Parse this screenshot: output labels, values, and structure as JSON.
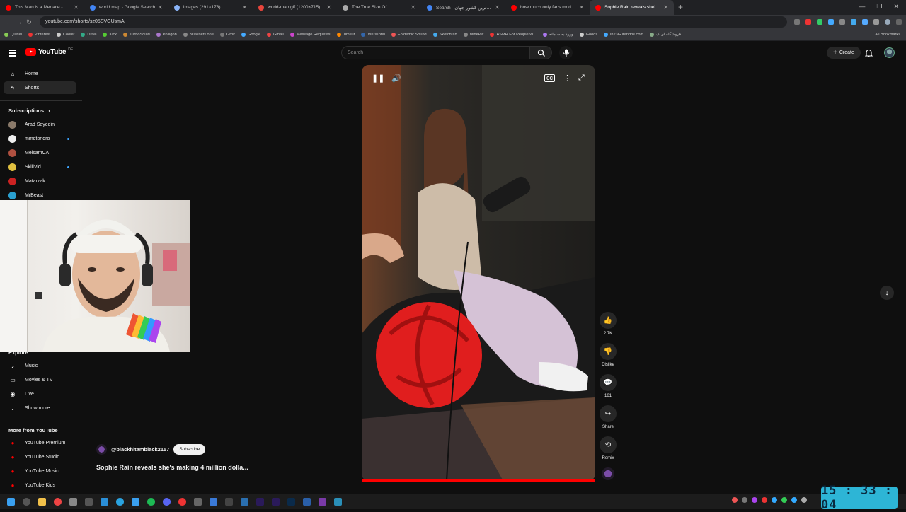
{
  "browser": {
    "tabs": [
      {
        "title": "This Man is a Menace - YouTube",
        "color": "#ff0000"
      },
      {
        "title": "world map - Google Search",
        "color": "#4285f4"
      },
      {
        "title": "images (291×173)",
        "color": "#8ab4f8"
      },
      {
        "title": "world-map.gif (1200×715)",
        "color": "#e8453c"
      },
      {
        "title": "The True Size Of ...",
        "color": "#aaaaaa"
      },
      {
        "title": "Search - پهناور ترین کشور جهان",
        "color": "#4285f4"
      },
      {
        "title": "how much only fans models m",
        "color": "#ff0000"
      },
      {
        "title": "Sophie Rain reveals she's m",
        "color": "#ff0000"
      }
    ],
    "new_tab": "+",
    "url": "youtube.com/shorts/sz05SVGUsmA",
    "bookmarks": [
      "Quixel",
      "Pinterest",
      "Cooler",
      "Drive",
      "Kick",
      "TurboSquid",
      "Poliigon",
      "3Dassets.one",
      "Grok",
      "Google",
      "Gmail",
      "Message Requests",
      "Time.ir",
      "VirusTotal",
      "Epidemic Sound",
      "Sketchfab",
      "MinePic",
      "ASMR For People W...",
      "ورود به سامانه",
      "Goods",
      "lh23G.irandns.com",
      "فروشگاه ای ک"
    ],
    "all_bookmarks": "All Bookmarks"
  },
  "youtube": {
    "logo_text": "YouTube",
    "region": "DE",
    "search_placeholder": "Search",
    "create_label": "Create",
    "sidebar": {
      "main": [
        {
          "label": "Home",
          "icon": "home-icon"
        },
        {
          "label": "Shorts",
          "icon": "shorts-icon"
        }
      ],
      "subscriptions_header": "Subscriptions",
      "subscriptions": [
        {
          "label": "Arad Seyedin",
          "color": "#8a7a6a",
          "dot": false
        },
        {
          "label": "mmdtondro",
          "color": "#eeeeee",
          "dot": true
        },
        {
          "label": "MeisamCA",
          "color": "#b05040",
          "dot": false
        },
        {
          "label": "SkillVid",
          "color": "#e0c040",
          "dot": true
        },
        {
          "label": "Matarzak",
          "color": "#cc2222",
          "dot": false
        },
        {
          "label": "MrBeast",
          "color": "#2aa0d0",
          "dot": false
        }
      ],
      "explore_header": "Explore",
      "explore": [
        {
          "label": "Music",
          "icon": "music-icon"
        },
        {
          "label": "Movies & TV",
          "icon": "movies-icon"
        },
        {
          "label": "Live",
          "icon": "live-icon"
        },
        {
          "label": "Show more",
          "icon": "chevron-down-icon"
        }
      ],
      "more_header": "More from YouTube",
      "more": [
        {
          "label": "YouTube Premium"
        },
        {
          "label": "YouTube Studio"
        },
        {
          "label": "YouTube Music"
        },
        {
          "label": "YouTube Kids"
        }
      ]
    },
    "short": {
      "channel": "@blackhitamblack2157",
      "subscribe": "Subscribe",
      "title": "Sophie Rain reveals she's making 4 million dolla...",
      "actions": {
        "like_count": "2.7K",
        "dislike_label": "Dislike",
        "comment_count": "161",
        "share_label": "Share",
        "remix_label": "Remix"
      },
      "progress": 1.0
    }
  },
  "taskbar": {
    "clock": "15 : 33 : 04"
  }
}
